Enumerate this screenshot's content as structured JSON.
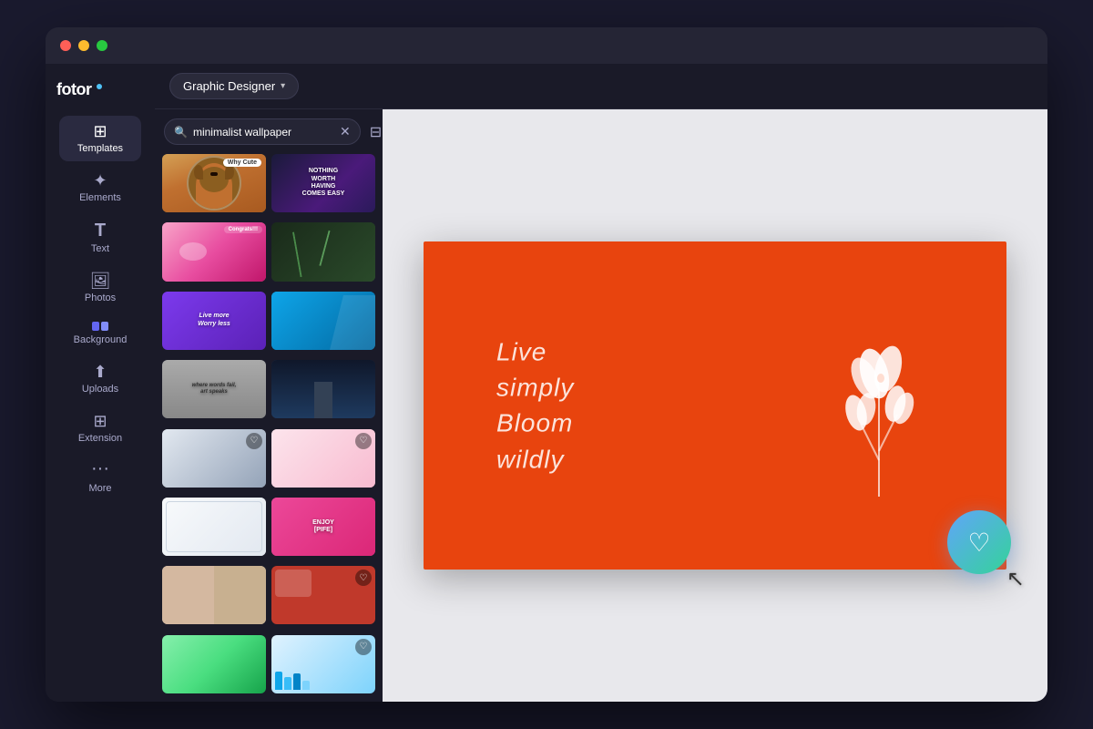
{
  "app": {
    "title": "Fotor - Graphic Designer",
    "logo": "fotor"
  },
  "titlebar": {
    "traffic_lights": [
      "red",
      "yellow",
      "green"
    ]
  },
  "header": {
    "dropdown_label": "Graphic Designer",
    "dropdown_chevron": "▾"
  },
  "sidebar": {
    "items": [
      {
        "id": "templates",
        "label": "Templates",
        "icon": "⊞",
        "active": true
      },
      {
        "id": "elements",
        "label": "Elements",
        "icon": "✦",
        "active": false
      },
      {
        "id": "text",
        "label": "Text",
        "icon": "T",
        "active": false
      },
      {
        "id": "photos",
        "label": "Photos",
        "icon": "🖼",
        "active": false
      },
      {
        "id": "background",
        "label": "Background",
        "icon": "⬛",
        "active": false
      },
      {
        "id": "uploads",
        "label": "Uploads",
        "icon": "⬆",
        "active": false
      },
      {
        "id": "extension",
        "label": "Extension",
        "icon": "⊞",
        "active": false
      }
    ],
    "more_label": "More",
    "more_dots": "···"
  },
  "search": {
    "placeholder": "minimalist wallpaper",
    "value": "minimalist wallpaper",
    "clear_icon": "✕",
    "filter_icon": "⊟"
  },
  "templates": {
    "cards": [
      {
        "id": 1,
        "color_class": "tc-1",
        "text": "Why Cute",
        "liked": false
      },
      {
        "id": 2,
        "color_class": "tc-2",
        "text": "NOTHING WORTH HAVING COMES EASY",
        "liked": false
      },
      {
        "id": 3,
        "color_class": "tc-3",
        "text": "Congrats!!!",
        "liked": false
      },
      {
        "id": 4,
        "color_class": "tc-4",
        "text": "",
        "liked": false
      },
      {
        "id": 5,
        "color_class": "tc-5",
        "text": "Live more Worry less",
        "liked": false
      },
      {
        "id": 6,
        "color_class": "tc-6",
        "text": "",
        "liked": false
      },
      {
        "id": 7,
        "color_class": "tc-7",
        "text": "where words fail, art speaks",
        "liked": false
      },
      {
        "id": 8,
        "color_class": "tc-8",
        "text": "",
        "liked": false
      },
      {
        "id": 9,
        "color_class": "tc-9",
        "text": "",
        "liked": true
      },
      {
        "id": 10,
        "color_class": "tc-10",
        "text": "",
        "liked": true
      },
      {
        "id": 11,
        "color_class": "tc-11",
        "text": "",
        "liked": false
      },
      {
        "id": 12,
        "color_class": "tc-12",
        "text": "ENJOY [PIFE]",
        "liked": false
      },
      {
        "id": 13,
        "color_class": "tc-13",
        "text": "",
        "liked": false
      },
      {
        "id": 14,
        "color_class": "tc-14",
        "text": "",
        "liked": true
      },
      {
        "id": 15,
        "color_class": "tc-15",
        "text": "",
        "liked": false
      },
      {
        "id": 16,
        "color_class": "tc-16",
        "text": "",
        "liked": false
      },
      {
        "id": 17,
        "color_class": "tc-17",
        "text": "",
        "liked": false
      },
      {
        "id": 18,
        "color_class": "tc-18",
        "text": "",
        "liked": true
      },
      {
        "id": 19,
        "color_class": "tc-19",
        "text": "",
        "liked": false
      },
      {
        "id": 20,
        "color_class": "tc-20",
        "text": "",
        "liked": false
      }
    ]
  },
  "canvas": {
    "background_color": "#e8440e",
    "text_line1": "Live",
    "text_line2": "simply",
    "text_line3": "Bloom",
    "text_line4": "wildly"
  },
  "fab": {
    "icon": "♡",
    "label": "Favorite",
    "gradient_start": "#60a5fa",
    "gradient_end": "#34d399"
  }
}
